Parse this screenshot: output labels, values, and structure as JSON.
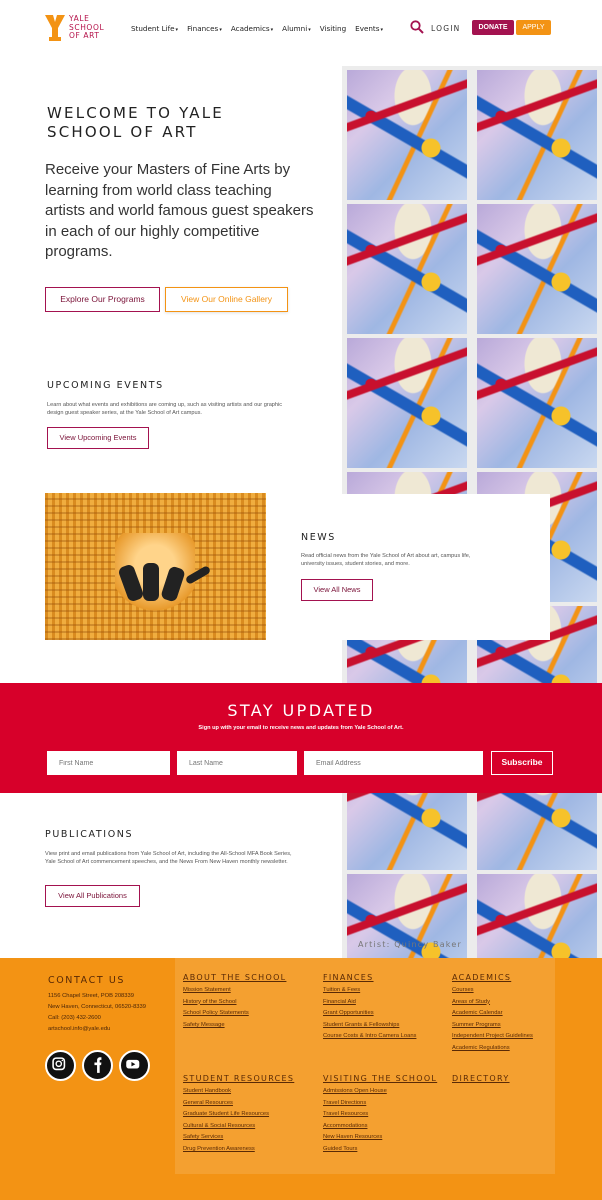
{
  "header": {
    "logo_lines": [
      "YALE",
      "SCHOOL",
      "OF ART"
    ],
    "nav": [
      {
        "label": "Student Life",
        "dropdown": true
      },
      {
        "label": "Finances",
        "dropdown": true
      },
      {
        "label": "Academics",
        "dropdown": true
      },
      {
        "label": "Alumni",
        "dropdown": true
      },
      {
        "label": "Visiting",
        "dropdown": false
      },
      {
        "label": "Events",
        "dropdown": true
      }
    ],
    "login": "LOGIN",
    "donate": "DONATE",
    "apply": "APPLY"
  },
  "colors": {
    "brand_crimson": "#a3124f",
    "accent_orange": "#f39314",
    "banner_red": "#d7002a"
  },
  "hero": {
    "title": "WELCOME TO YALE SCHOOL OF ART",
    "body": "Receive your Masters of Fine Arts by learning from world class teaching artists and world famous guest speakers in each of our highly competitive programs.",
    "primary_button": "Explore Our Programs",
    "secondary_button": "View Our Online Gallery"
  },
  "events": {
    "title": "UPCOMING EVENTS",
    "body": "Learn about what events and exhibitions are coming up, such as visiting artists and our graphic design guest speaker series, at the Yale School of Art campus.",
    "button": "View Upcoming Events"
  },
  "news": {
    "title": "NEWS",
    "body": "Read official news from the Yale School of Art about art, campus life, university issues, student stories, and more.",
    "button": "View All News"
  },
  "stay_updated": {
    "title": "STAY UPDATED",
    "subtitle": "Sign up with your email to receive news and updates from Yale School of Art.",
    "first_name_placeholder": "First Name",
    "last_name_placeholder": "Last Name",
    "email_placeholder": "Email Address",
    "subscribe": "Subscribe"
  },
  "publications": {
    "title": "PUBLICATIONS",
    "body": "View print and email publications from Yale School of Art, including the All-School MFA Book Series, Yale School of Art commencement speeches, and the News From New Haven monthly newsletter.",
    "button": "View All Publications"
  },
  "artwork": {
    "caption": "Artist: Quincy Baker"
  },
  "footer": {
    "contact_title": "CONTACT US",
    "address_line1": "1156 Chapel Street, POB 208339",
    "address_line2": "New Haven, Connecticut, 06520-8339",
    "phone": "Call: (203) 432-2600",
    "email": "artschool.info@yale.edu",
    "social_icons": [
      "instagram-icon",
      "facebook-icon",
      "youtube-icon"
    ],
    "columns": [
      {
        "title": "ABOUT THE SCHOOL",
        "links": [
          "Mission Statement",
          "History of the School",
          "School Policy Statements",
          "Safety Message"
        ]
      },
      {
        "title": "FINANCES",
        "links": [
          "Tuition & Fees",
          "Financial Aid",
          "Grant Opportunities",
          "Student Grants & Fellowships",
          "Course Costs & Intro Camera Loans"
        ]
      },
      {
        "title": "ACADEMICS",
        "links": [
          "Courses",
          "Areas of Study",
          "Academic Calendar",
          "Summer Programs",
          "Independent Project Guidelines",
          "Academic Regulations"
        ]
      },
      {
        "title": "STUDENT RESOURCES",
        "links": [
          "Student Handbook",
          "General Resources",
          "Graduate Student Life Resources",
          "Cultural & Social Resources",
          "Safety Services",
          "Drug Prevention Awareness"
        ]
      },
      {
        "title": "VISITING THE SCHOOL",
        "links": [
          "Admissions Open House",
          "Travel Directions",
          "Travel Resources",
          "Accommodations",
          "New Haven Resources",
          "Guided Tours"
        ]
      },
      {
        "title": "DIRECTORY",
        "links": []
      }
    ]
  }
}
